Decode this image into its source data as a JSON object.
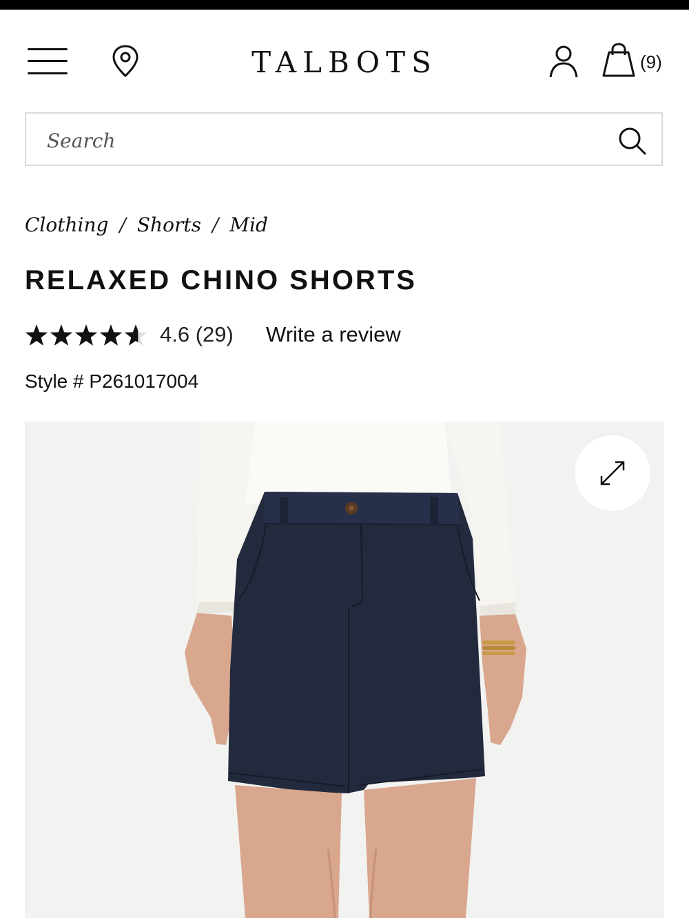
{
  "header": {
    "logo": "TALBOTS",
    "bag_count": "(9)",
    "icons": [
      "menu-icon",
      "location-pin-icon",
      "account-icon",
      "shopping-bag-icon"
    ]
  },
  "search": {
    "placeholder": "Search",
    "icon": "search-icon"
  },
  "breadcrumb": [
    "Clothing",
    "Shorts",
    "Mid"
  ],
  "product": {
    "title": "RELAXED CHINO SHORTS",
    "rating_stars": 4.6,
    "rating_text": "4.6 (29)",
    "review_link": "Write a review",
    "style": "Style # P261017004",
    "image_icon": "expand-icon"
  },
  "colors": {
    "text": "#111111",
    "search_border": "#d9d9d9",
    "image_background": "#f2f2f1",
    "shorts": "#232a3d",
    "top": "#f7f5f0"
  }
}
